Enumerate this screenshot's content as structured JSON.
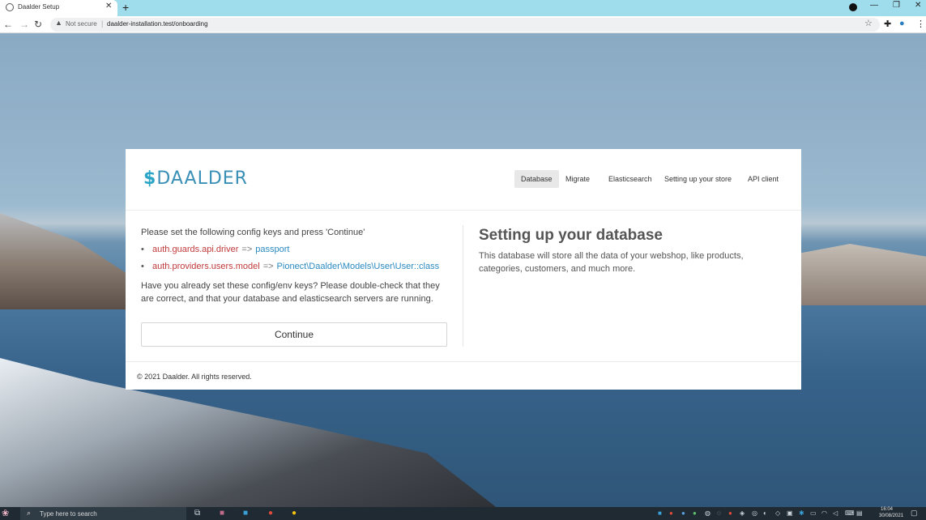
{
  "browser": {
    "tab_title": "Daalder Setup",
    "security_label": "Not secure",
    "url": "daalder-installation.test/onboarding"
  },
  "card": {
    "logo_text": "DAALDER",
    "logo_symbol": "$",
    "steps": [
      {
        "label": "Database",
        "active": true
      },
      {
        "label": "Migrate",
        "active": false
      },
      {
        "label": "Elasticsearch",
        "active": false
      },
      {
        "label": "Setting up your store",
        "active": false
      },
      {
        "label": "API client",
        "active": false
      }
    ],
    "intro": "Please set the following config keys and press 'Continue'",
    "config_items": [
      {
        "key": "auth.guards.api.driver",
        "arrow": "=>",
        "value": "passport"
      },
      {
        "key": "auth.providers.users.model",
        "arrow": "=>",
        "value": "Pionect\\Daalder\\Models\\User\\User::class"
      }
    ],
    "hint": "Have you already set these config/env keys? Please double-check that they are correct, and that your database and elasticsearch servers are running.",
    "continue_label": "Continue",
    "section_title": "Setting up your database",
    "section_desc": "This database will store all the data of your webshop, like products, categories, customers, and much more.",
    "footer": "© 2021 Daalder. All rights reserved."
  },
  "taskbar": {
    "search_placeholder": "Type here to search",
    "time": "16:04",
    "date": "30/08/2021"
  },
  "colors": {
    "accent": "#2aa5c6",
    "config_key": "#c0393b",
    "config_value": "#2a8ac0",
    "tabbar": "#9fdcec"
  }
}
